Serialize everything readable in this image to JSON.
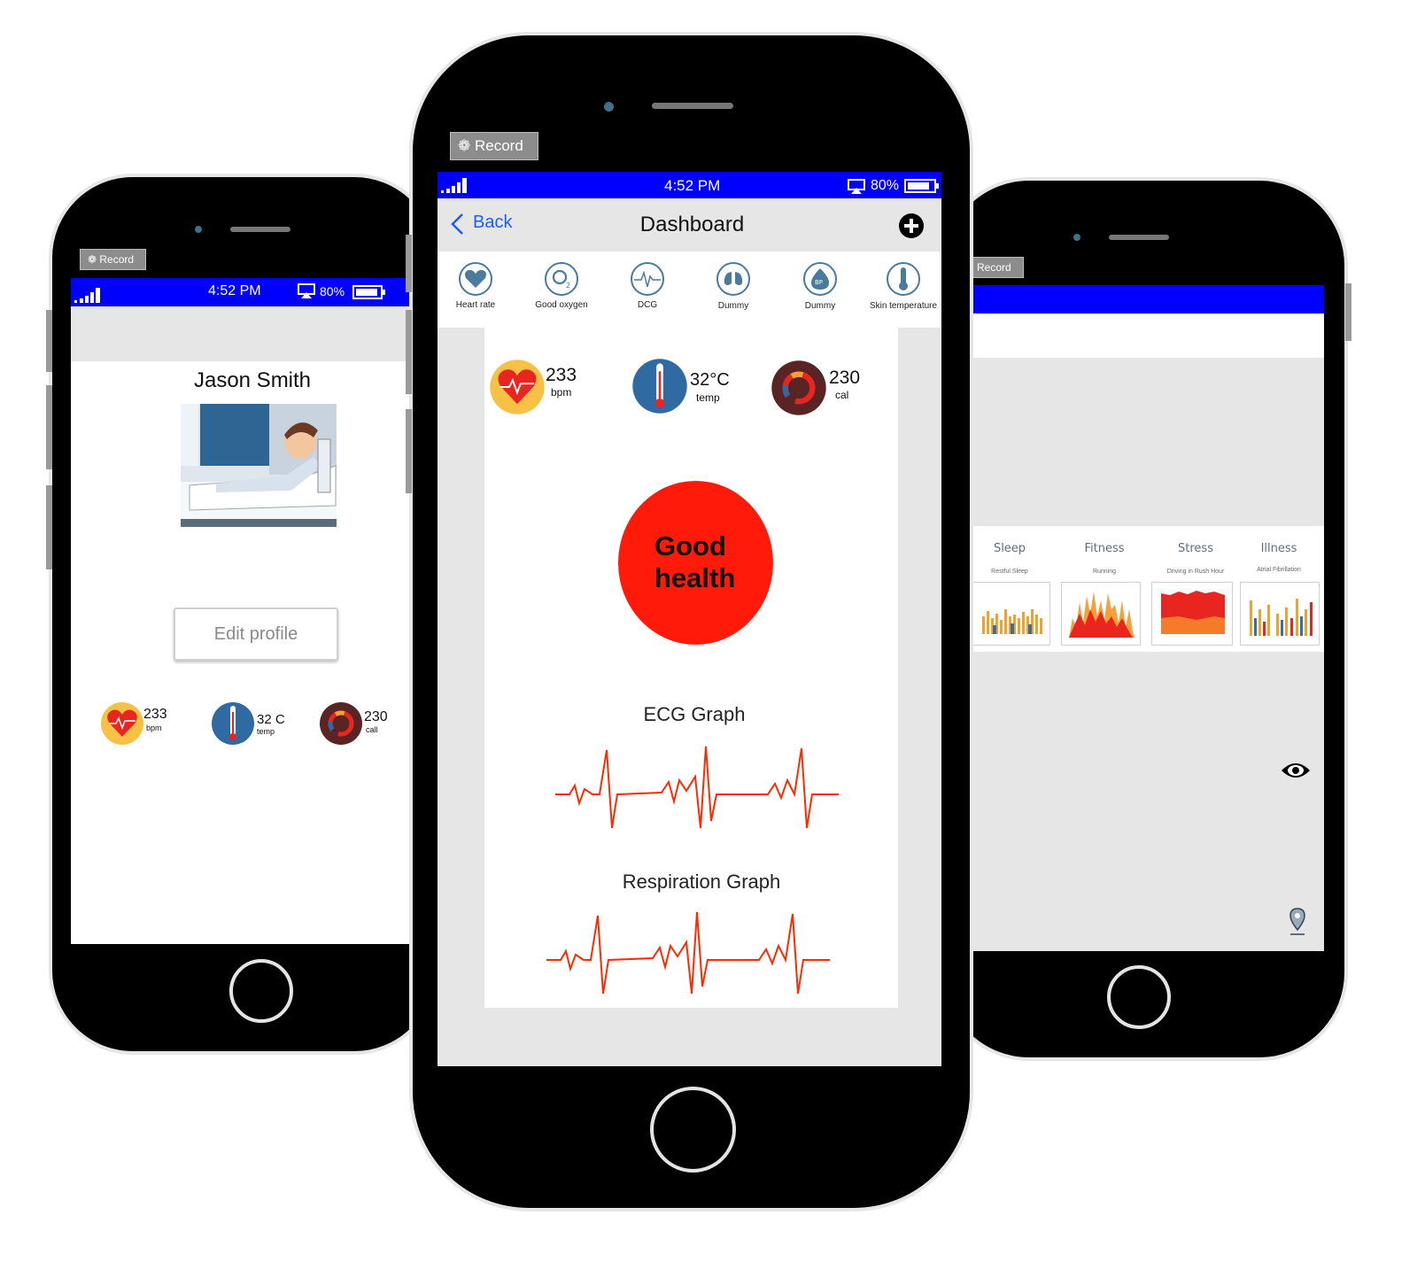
{
  "colors": {
    "status_blue": "#0000ff",
    "accent_blue": "#1a5cff",
    "good_health_red": "#ff1a0a",
    "ecg_red": "#ff2a00"
  },
  "left_phone": {
    "record_label": "Record",
    "status": {
      "time": "4:52 PM",
      "battery": "80%"
    },
    "profile_name": "Jason Smith",
    "edit_profile_label": "Edit profile",
    "metrics": [
      {
        "value": "233",
        "unit": "bpm",
        "icon": "heart-icon"
      },
      {
        "value": "32 C",
        "unit": "temp",
        "icon": "thermometer-icon"
      },
      {
        "value": "230",
        "unit": "call",
        "icon": "calories-icon"
      }
    ]
  },
  "center_phone": {
    "record_label": "Record",
    "status": {
      "time": "4:52 PM",
      "battery": "80%"
    },
    "nav": {
      "back_label": "Back",
      "title": "Dashboard"
    },
    "sensor_tabs": [
      {
        "label": "Heart rate",
        "icon": "heart-icon"
      },
      {
        "label": "Good oxygen",
        "icon": "oxygen-icon"
      },
      {
        "label": "DCG",
        "icon": "ecg-icon"
      },
      {
        "label": "Dummy",
        "icon": "lungs-icon"
      },
      {
        "label": "Dummy",
        "icon": "bp-icon"
      },
      {
        "label": "Skin temperature",
        "icon": "thermometer-icon"
      }
    ],
    "metrics": [
      {
        "value": "233",
        "unit": "bpm",
        "icon": "heart-icon"
      },
      {
        "value": "32°C",
        "unit": "temp",
        "icon": "thermometer-icon"
      },
      {
        "value": "230",
        "unit": "cal",
        "icon": "calories-icon"
      }
    ],
    "health_status_line1": "Good",
    "health_status_line2": "health",
    "ecg_title": "ECG Graph",
    "respiration_title": "Respiration Graph"
  },
  "right_phone": {
    "record_label": "Record",
    "categories": [
      {
        "name": "Sleep",
        "subtitle": "Restful Sleep"
      },
      {
        "name": "Fitness",
        "subtitle": "Running"
      },
      {
        "name": "Stress",
        "subtitle": "Driving in Rush Hour"
      },
      {
        "name": "Illness",
        "subtitle": "Atrial Fibrillation"
      }
    ]
  }
}
